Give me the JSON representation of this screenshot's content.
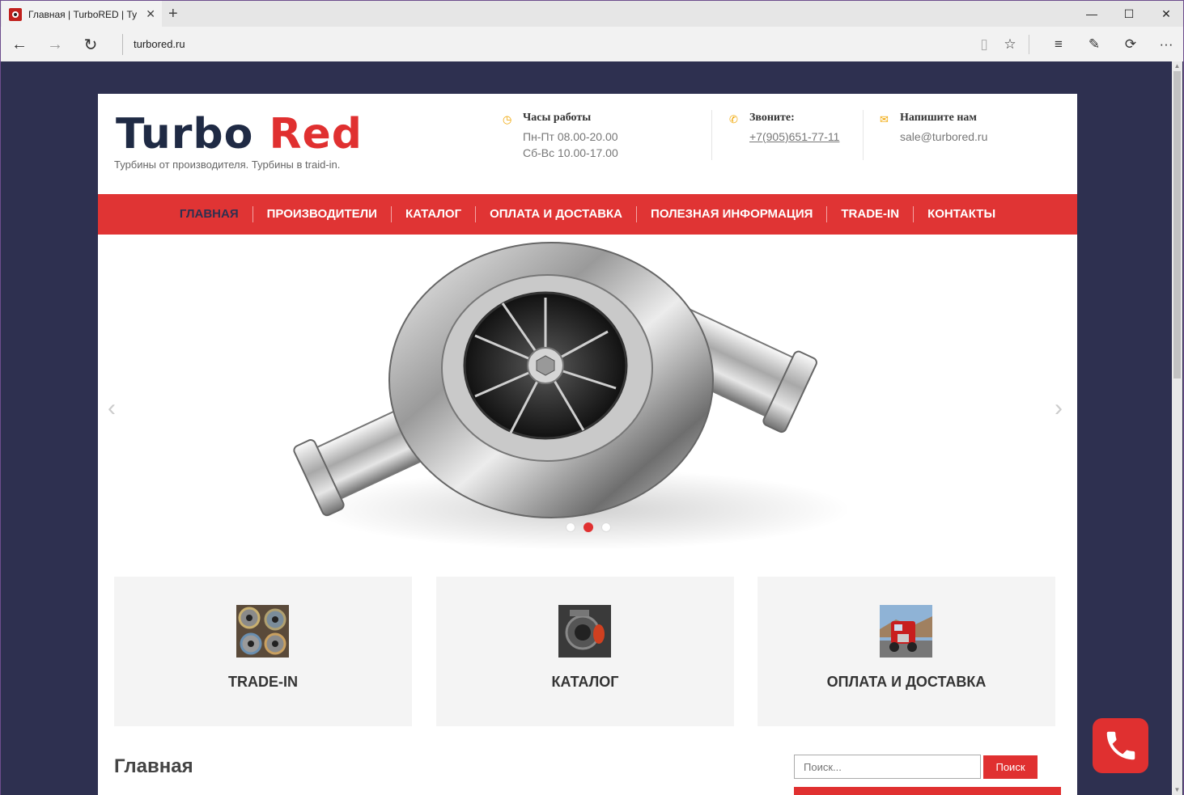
{
  "browser": {
    "tab_title": "Главная | TurboRED | Ту",
    "url": "turbored.ru"
  },
  "header": {
    "logo_part1": "Turbo",
    "logo_part2": "Red",
    "tagline": "Турбины от производителя. Турбины в traid-in.",
    "hours": {
      "title": "Часы работы",
      "line1": "Пн-Пт 08.00-20.00",
      "line2": "Сб-Вс 10.00-17.00"
    },
    "call": {
      "title": "Звоните:",
      "phone": "+7(905)651-77-11"
    },
    "email": {
      "title": "Напишите нам",
      "address": "sale@turbored.ru"
    }
  },
  "menu": {
    "items": [
      {
        "label": "ГЛАВНАЯ",
        "active": true
      },
      {
        "label": "ПРОИЗВОДИТЕЛИ"
      },
      {
        "label": "КАТАЛОГ"
      },
      {
        "label": "ОПЛАТА И ДОСТАВКА"
      },
      {
        "label": "ПОЛЕЗНАЯ ИНФОРМАЦИЯ"
      },
      {
        "label": "TRADE-IN"
      },
      {
        "label": "КОНТАКТЫ"
      }
    ]
  },
  "slider": {
    "slide_count": 3,
    "active_slide": 2
  },
  "features": [
    {
      "label": "TRADE-IN"
    },
    {
      "label": "КАТАЛОГ"
    },
    {
      "label": "ОПЛАТА И ДОСТАВКА"
    }
  ],
  "main": {
    "heading": "Главная"
  },
  "search": {
    "placeholder": "Поиск...",
    "button_label": "Поиск"
  },
  "colors": {
    "accent": "#e03434",
    "navy": "#2e3050",
    "icon": "#f0a500"
  }
}
